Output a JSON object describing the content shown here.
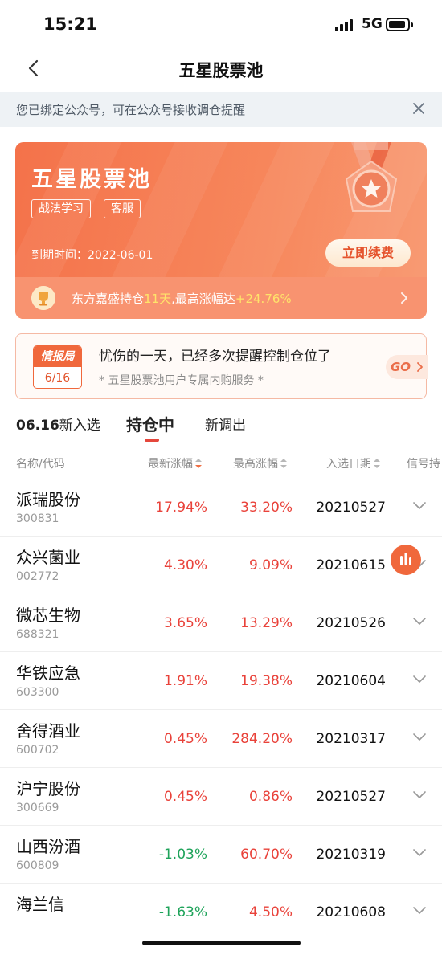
{
  "status_bar": {
    "time": "15:21",
    "network": "5G"
  },
  "nav": {
    "title": "五星股票池"
  },
  "notice": {
    "text": "您已绑定公众号，可在公众号接收调仓提醒"
  },
  "hero": {
    "title": "五星股票池",
    "tags": [
      "战法学习",
      "客服"
    ],
    "expire_label": "到期时间：",
    "expire_date": "2022-06-01",
    "renew_label": "立即续费",
    "banner_prefix": "东方嘉盛持仓",
    "banner_days": "11天",
    "banner_mid": ",最高涨幅达",
    "banner_gain": "+24.76%"
  },
  "intel": {
    "badge_title": "情报局",
    "badge_date": "6/16",
    "title": "忧伤的一天，已经多次提醒控制仓位了",
    "subtitle": "* 五星股票池用户专属内购服务 *",
    "go_label": "GO"
  },
  "tabs": [
    {
      "num": "06.16",
      "label": "新入选"
    },
    {
      "num": "",
      "label": "持仓中"
    },
    {
      "num": "",
      "label": "新调出"
    }
  ],
  "table": {
    "headers": [
      "名称/代码",
      "最新涨幅",
      "最高涨幅",
      "入选日期",
      "信号持"
    ],
    "rows": [
      {
        "name": "派瑞股份",
        "code": "300831",
        "change": "17.94%",
        "max": "33.20%",
        "date": "20210527",
        "dir": "up"
      },
      {
        "name": "众兴菌业",
        "code": "002772",
        "change": "4.30%",
        "max": "9.09%",
        "date": "20210615",
        "dir": "up"
      },
      {
        "name": "微芯生物",
        "code": "688321",
        "change": "3.65%",
        "max": "13.29%",
        "date": "20210526",
        "dir": "up"
      },
      {
        "name": "华铁应急",
        "code": "603300",
        "change": "1.91%",
        "max": "19.38%",
        "date": "20210604",
        "dir": "up"
      },
      {
        "name": "舍得酒业",
        "code": "600702",
        "change": "0.45%",
        "max": "284.20%",
        "date": "20210317",
        "dir": "up"
      },
      {
        "name": "沪宁股份",
        "code": "300669",
        "change": "0.45%",
        "max": "0.86%",
        "date": "20210527",
        "dir": "up"
      },
      {
        "name": "山西汾酒",
        "code": "600809",
        "change": "-1.03%",
        "max": "60.70%",
        "date": "20210319",
        "dir": "down"
      },
      {
        "name": "海兰信",
        "code": "",
        "change": "-1.63%",
        "max": "4.50%",
        "date": "20210608",
        "dir": "down"
      }
    ]
  },
  "colors": {
    "accent": "#f0683c",
    "up": "#e9423a",
    "down": "#1ea35a"
  }
}
